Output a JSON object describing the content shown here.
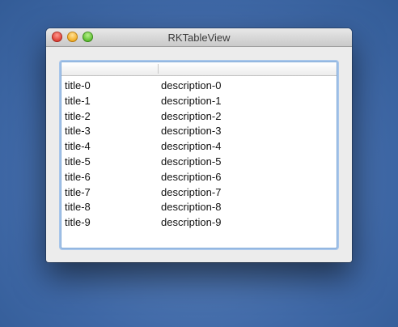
{
  "window": {
    "title": "RKTableView"
  },
  "table": {
    "columns": [
      "",
      ""
    ],
    "rows": [
      {
        "title": "title-0",
        "description": "description-0"
      },
      {
        "title": "title-1",
        "description": "description-1"
      },
      {
        "title": "title-2",
        "description": "description-2"
      },
      {
        "title": "title-3",
        "description": "description-3"
      },
      {
        "title": "title-4",
        "description": "description-4"
      },
      {
        "title": "title-5",
        "description": "description-5"
      },
      {
        "title": "title-6",
        "description": "description-6"
      },
      {
        "title": "title-7",
        "description": "description-7"
      },
      {
        "title": "title-8",
        "description": "description-8"
      },
      {
        "title": "title-9",
        "description": "description-9"
      }
    ]
  }
}
